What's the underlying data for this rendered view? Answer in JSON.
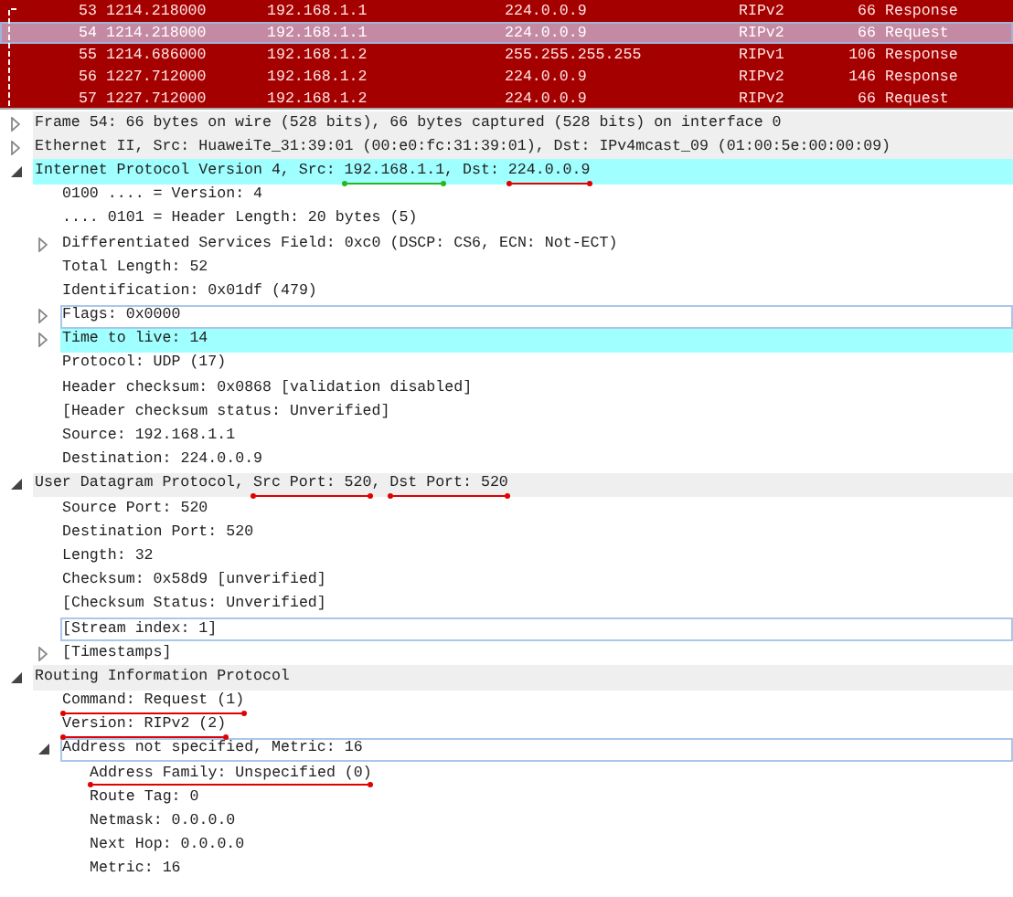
{
  "packet_list": {
    "rows": [
      {
        "no": "53",
        "time": "1214.218000",
        "source": "192.168.1.1",
        "destination": "224.0.0.9",
        "protocol": "RIPv2",
        "length": "66",
        "info": "Response",
        "selected": false
      },
      {
        "no": "54",
        "time": "1214.218000",
        "source": "192.168.1.1",
        "destination": "224.0.0.9",
        "protocol": "RIPv2",
        "length": "66",
        "info": "Request",
        "selected": true
      },
      {
        "no": "55",
        "time": "1214.686000",
        "source": "192.168.1.2",
        "destination": "255.255.255.255",
        "protocol": "RIPv1",
        "length": "106",
        "info": "Response",
        "selected": false
      },
      {
        "no": "56",
        "time": "1227.712000",
        "source": "192.168.1.2",
        "destination": "224.0.0.9",
        "protocol": "RIPv2",
        "length": "146",
        "info": "Response",
        "selected": false
      },
      {
        "no": "57",
        "time": "1227.712000",
        "source": "192.168.1.2",
        "destination": "224.0.0.9",
        "protocol": "RIPv2",
        "length": "66",
        "info": "Request",
        "selected": false
      }
    ]
  },
  "details": [
    {
      "kind": "protocol",
      "parts": [
        {
          "text": "Frame 54: 66 bytes on wire (528 bits), 66 bytes captured (528 bits) on interface 0"
        }
      ],
      "expanded": false,
      "selected": false,
      "focused": false
    },
    {
      "kind": "protocol",
      "parts": [
        {
          "text": "Ethernet II, Src: HuaweiTe_31:39:01 (00:e0:fc:31:39:01), Dst: IPv4mcast_09 (01:00:5e:00:00:09)"
        }
      ],
      "expanded": false,
      "selected": false,
      "focused": false
    },
    {
      "kind": "protocol",
      "parts": [
        {
          "text": "Internet Protocol Version 4, Src: "
        },
        {
          "text": "192.168.1.1",
          "color": "#22b822"
        },
        {
          "text": ", Dst: "
        },
        {
          "text": "224.0.0.9",
          "color": "#e00000"
        }
      ],
      "expanded": true,
      "selected": true,
      "focused": false,
      "children": [
        {
          "kind": "field",
          "parts": [
            {
              "text": "0100 .... = Version: 4"
            }
          ],
          "selected": false,
          "focused": false
        },
        {
          "kind": "field",
          "parts": [
            {
              "text": ".... 0101 = Header Length: 20 bytes (5)"
            }
          ],
          "selected": false,
          "focused": false
        },
        {
          "kind": "field",
          "parts": [
            {
              "text": "Differentiated Services Field: 0xc0 (DSCP: CS6, ECN: Not-ECT)"
            }
          ],
          "expanded": false,
          "selected": false,
          "focused": false
        },
        {
          "kind": "field",
          "parts": [
            {
              "text": "Total Length: 52"
            }
          ],
          "selected": false,
          "focused": false
        },
        {
          "kind": "field",
          "parts": [
            {
              "text": "Identification: 0x01df (479)"
            }
          ],
          "selected": false,
          "focused": false
        },
        {
          "kind": "field",
          "parts": [
            {
              "text": "Flags: 0x0000"
            }
          ],
          "expanded": false,
          "selected": false,
          "focused": true
        },
        {
          "kind": "field",
          "parts": [
            {
              "text": "Time to live: 14"
            }
          ],
          "expanded": false,
          "selected": true,
          "focused": false
        },
        {
          "kind": "field",
          "parts": [
            {
              "text": "Protocol: UDP (17)"
            }
          ],
          "selected": false,
          "focused": false
        },
        {
          "kind": "field",
          "parts": [
            {
              "text": "Header checksum: 0x0868 [validation disabled]"
            }
          ],
          "selected": false,
          "focused": false
        },
        {
          "kind": "field",
          "parts": [
            {
              "text": "[Header checksum status: Unverified]"
            }
          ],
          "selected": false,
          "focused": false
        },
        {
          "kind": "field",
          "parts": [
            {
              "text": "Source: 192.168.1.1"
            }
          ],
          "selected": false,
          "focused": false
        },
        {
          "kind": "field",
          "parts": [
            {
              "text": "Destination: 224.0.0.9"
            }
          ],
          "selected": false,
          "focused": false
        }
      ]
    },
    {
      "kind": "protocol",
      "parts": [
        {
          "text": "User Datagram Protocol, "
        },
        {
          "text": "Src Port: 520",
          "color": "#e00000"
        },
        {
          "text": ", "
        },
        {
          "text": "Dst Port: 520",
          "color": "#e00000"
        }
      ],
      "expanded": true,
      "selected": false,
      "focused": false,
      "children": [
        {
          "kind": "field",
          "parts": [
            {
              "text": "Source Port: 520"
            }
          ],
          "selected": false,
          "focused": false
        },
        {
          "kind": "field",
          "parts": [
            {
              "text": "Destination Port: 520"
            }
          ],
          "selected": false,
          "focused": false
        },
        {
          "kind": "field",
          "parts": [
            {
              "text": "Length: 32"
            }
          ],
          "selected": false,
          "focused": false
        },
        {
          "kind": "field",
          "parts": [
            {
              "text": "Checksum: 0x58d9 [unverified]"
            }
          ],
          "selected": false,
          "focused": false
        },
        {
          "kind": "field",
          "parts": [
            {
              "text": "[Checksum Status: Unverified]"
            }
          ],
          "selected": false,
          "focused": false
        },
        {
          "kind": "field",
          "parts": [
            {
              "text": "[Stream index: 1]"
            }
          ],
          "selected": false,
          "focused": true
        },
        {
          "kind": "field",
          "parts": [
            {
              "text": "[Timestamps]"
            }
          ],
          "expanded": false,
          "selected": false,
          "focused": false
        }
      ]
    },
    {
      "kind": "protocol",
      "parts": [
        {
          "text": "Routing Information Protocol"
        }
      ],
      "expanded": true,
      "selected": false,
      "focused": false,
      "children": [
        {
          "kind": "field",
          "parts": [
            {
              "text": "Command: Request (1)",
              "color": "#e00000"
            }
          ],
          "selected": false,
          "focused": false
        },
        {
          "kind": "field",
          "parts": [
            {
              "text": "Version: RIPv2 (2)",
              "color": "#e00000"
            }
          ],
          "selected": false,
          "focused": false
        },
        {
          "kind": "field",
          "parts": [
            {
              "text": "Address not specified, Metric: 16"
            }
          ],
          "expanded": true,
          "selected": false,
          "focused": true,
          "children": [
            {
              "kind": "field",
              "parts": [
                {
                  "text": "Address Family: Unspecified (0)",
                  "color": "#e00000"
                }
              ],
              "selected": false,
              "focused": false
            },
            {
              "kind": "field",
              "parts": [
                {
                  "text": "Route Tag: 0"
                }
              ],
              "selected": false,
              "focused": false
            },
            {
              "kind": "field",
              "parts": [
                {
                  "text": "Netmask: 0.0.0.0"
                }
              ],
              "selected": false,
              "focused": false
            },
            {
              "kind": "field",
              "parts": [
                {
                  "text": "Next Hop: 0.0.0.0"
                }
              ],
              "selected": false,
              "focused": false
            },
            {
              "kind": "field",
              "parts": [
                {
                  "text": "Metric: 16"
                }
              ],
              "selected": false,
              "focused": false
            }
          ]
        }
      ]
    }
  ]
}
